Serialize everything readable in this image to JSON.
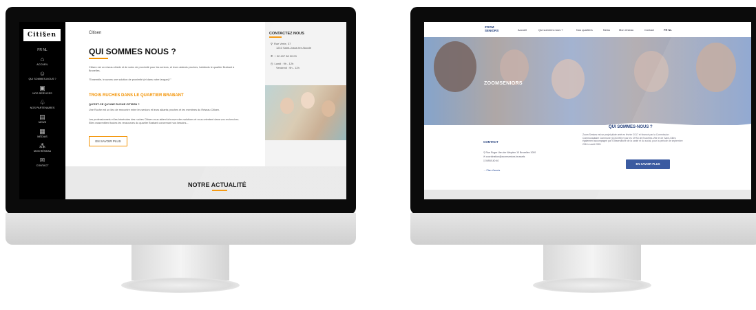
{
  "citisen": {
    "logo": "Citi§en",
    "lang": "FR  NL",
    "nav": [
      {
        "label": "ACCUEIL",
        "icon": "home-icon",
        "glyph": "⌂"
      },
      {
        "label": "QUI SOMMES-NOUS ?",
        "icon": "people-icon",
        "glyph": "☺"
      },
      {
        "label": "NOS SERVICES",
        "icon": "services-icon",
        "glyph": "▣"
      },
      {
        "label": "NOS PARTENAIRES",
        "icon": "handshake-icon",
        "glyph": "♧"
      },
      {
        "label": "NEWS",
        "icon": "news-icon",
        "glyph": "▤"
      },
      {
        "label": "MÉDIAS",
        "icon": "media-icon",
        "glyph": "▦"
      },
      {
        "label": "MON RÉSEAU",
        "icon": "network-icon",
        "glyph": "⁂"
      },
      {
        "label": "CONTACT",
        "icon": "contact-icon",
        "glyph": "✉"
      }
    ],
    "brand": "Citisen",
    "title": "QUI SOMMES NOUS ?",
    "intro": "Citisen est un réseau d'aide et de soins de proximité pour les seniors, et leurs aidants proches, habitants le quartier Brabant à Bruxelles.",
    "quote": "\"Ensemble, trouvons une solution de proximité (et dans votre langue) !\"",
    "subtitle": "TROIS RUCHES DANS LE QUARTIER BRABANT",
    "question": "QU'EST-CE QU'UNE RUCHE CITISEN ?",
    "answer": "Une Ruche est un lieu de rencontre entre les seniors et leurs aidants proches et les membres du Réseau Citisen.",
    "body": "Les professionnels et les bénévoles des ruches Citisen vous aident à trouver des solutions et vous orientent dans vos recherches. Elles rassemblent toutes les ressources du quartier Brabant concernant vos besoins...",
    "button": "EN SAVOIR PLUS",
    "contact_title": "CONTACTEZ NOUS",
    "address1": "Rue Verte, 37",
    "address2": "1210 Saint-Josse-ten-Noode",
    "phone": "+ 32 497 38 00 03",
    "hours1": "Lundi : 9h - 12h",
    "hours2": "Vendredi : 9h - 12h",
    "news_title": "NOTRE ACTUALITÉ",
    "accent": "#f39200"
  },
  "zoomseniors": {
    "logo_line1": "ZOOM",
    "logo_line2": "SENIORS",
    "nav": [
      "Accueil",
      "Qui sommes nous ?",
      "Nos quartiers",
      "News",
      "Mon réseau",
      "Contact"
    ],
    "lang": "FR  NL",
    "hero_title": "ZOOMSENIORS",
    "contact_title": "CONTACT",
    "address": "Rue Roger Van der Weyden 10 Bruxelles 1000",
    "email": "coordination@zoomseniors.brussels",
    "phone": "0490/140 40",
    "map_link": "Plan d'accès",
    "about_title": "QUI SOMMES-NOUS ?",
    "about_text": "Zoom Seniors est un projet pilote créé en février 2017 et financé par la Commission Communautaire Commune (COCOM) et par les CPAS de Bruxelles-Ville et de Saint-Gilles également accompagné par l'Observatoire de la santé et du social, pour la période de septembre 2016 à août 2020.",
    "button": "EN SAVOIR PLUS",
    "accent": "#2a4d99"
  }
}
